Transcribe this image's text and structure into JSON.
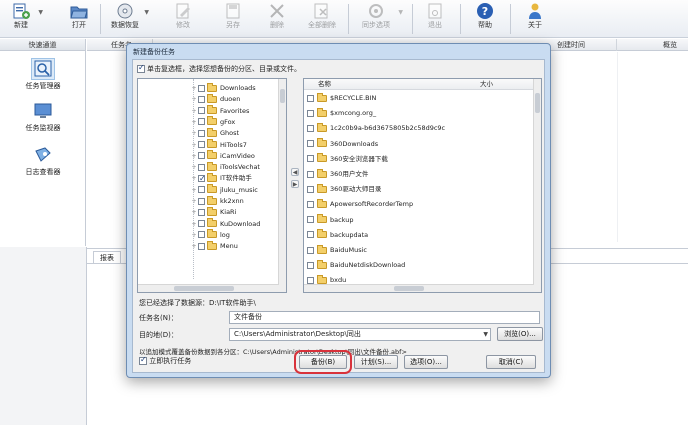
{
  "toolbar": {
    "items": [
      {
        "label": "新建",
        "icon": "new-task-icon"
      },
      {
        "label": "打开",
        "icon": "open-folder-icon"
      },
      {
        "label": "数据恢复",
        "icon": "restore-icon"
      },
      {
        "label": "修改",
        "icon": "edit-icon"
      },
      {
        "label": "另存",
        "icon": "save-as-icon"
      },
      {
        "label": "删除",
        "icon": "delete-icon"
      },
      {
        "label": "全部删除",
        "icon": "delete-all-icon"
      },
      {
        "label": "同步选项",
        "icon": "sync-options-icon"
      },
      {
        "label": "退出",
        "icon": "exit-icon"
      },
      {
        "label": "帮助",
        "icon": "help-icon"
      },
      {
        "label": "关于",
        "icon": "about-icon"
      }
    ]
  },
  "left_panel": {
    "header": "快速通道",
    "items": [
      {
        "label": "任务管理器",
        "icon": "task-manager-icon"
      },
      {
        "label": "任务监视器",
        "icon": "task-monitor-icon"
      },
      {
        "label": "日志查看器",
        "icon": "log-viewer-icon"
      }
    ]
  },
  "main_list": {
    "columns": [
      "任务名",
      "创建时间",
      "概览"
    ]
  },
  "report": {
    "tab": "报表"
  },
  "dialog": {
    "title": "新建备份任务",
    "hint": "单击复选框，选择您想备份的分区、目录或文件。",
    "tree_nodes": [
      {
        "label": "Downloads",
        "checked": false
      },
      {
        "label": "duoen",
        "checked": false
      },
      {
        "label": "Favorites",
        "checked": false
      },
      {
        "label": "gFox",
        "checked": false
      },
      {
        "label": "Ghost",
        "checked": false
      },
      {
        "label": "HiTools7",
        "checked": false
      },
      {
        "label": "iCamVideo",
        "checked": false
      },
      {
        "label": "iToolsVechat",
        "checked": false
      },
      {
        "label": "IT软件助手",
        "checked": true
      },
      {
        "label": "jluku_music",
        "checked": false
      },
      {
        "label": "kk2xnn",
        "checked": false
      },
      {
        "label": "KiaRi",
        "checked": false
      },
      {
        "label": "KuDownload",
        "checked": false
      },
      {
        "label": "log",
        "checked": false
      },
      {
        "label": "Menu",
        "checked": false
      }
    ],
    "files_header": {
      "name": "名称",
      "size": "大小"
    },
    "files": [
      "$RECYCLE.BIN",
      "$xmcong.org_",
      "1c2c0b9a-b6d3675805b2c58d9c9c",
      "360Downloads",
      "360安全浏览器下载",
      "360用户文件",
      "360驱动大师目录",
      "ApowersoftRecorderTemp",
      "backup",
      "backupdata",
      "BaiduMusic",
      "BaiduNetdiskDownload",
      "bxdu"
    ],
    "selected_label": "您已经选择了数据源：D:\\IT软件助手\\",
    "task_name_label": "任务名(N)：",
    "task_name_value": "文件备份",
    "destination_label": "目的地(D)：",
    "destination_value": "C:\\Users\\Administrator\\Desktop\\同出",
    "browse_label": "浏览(O)...",
    "incremental_text": "以追加模式覆盖备份数据到各分区：C:\\Users\\Administrator\\Desktop\\同出\\文件备份.abf>",
    "autorun_label": "立即执行任务",
    "autorun_checked": true,
    "buttons": {
      "backup": "备份(B)",
      "schedule": "计划(S)...",
      "options": "选项(O)...",
      "cancel": "取消(C)"
    }
  }
}
